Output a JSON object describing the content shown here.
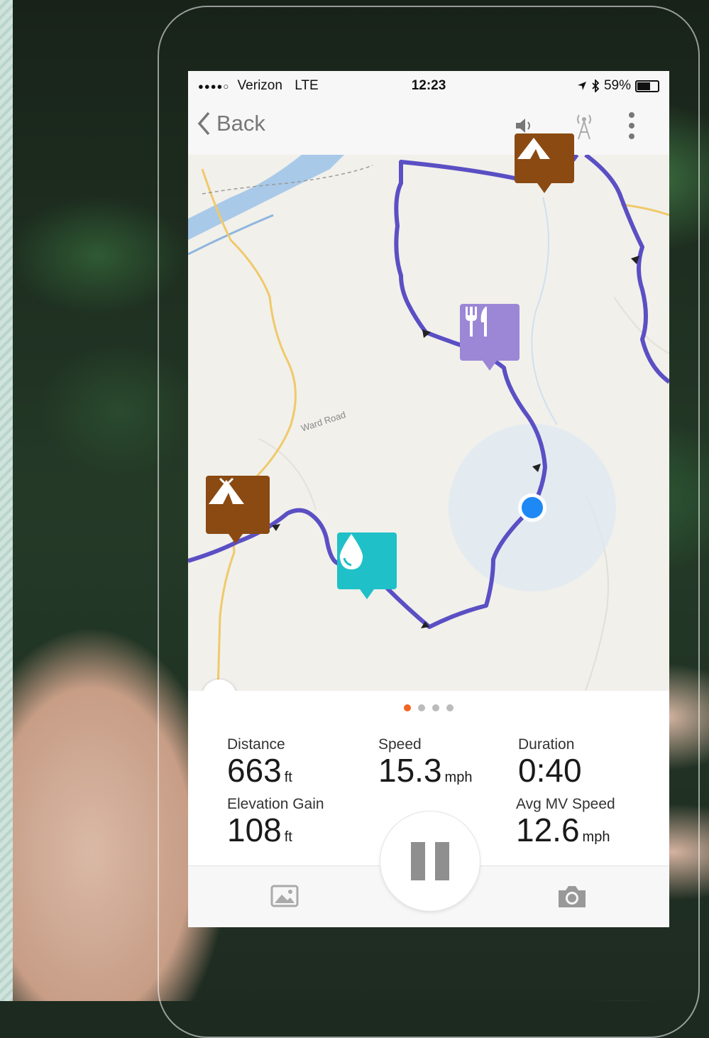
{
  "status_bar": {
    "signal": "●●●●○",
    "carrier": "Verizon",
    "network": "LTE",
    "time": "12:23",
    "battery": "59%"
  },
  "nav": {
    "back_label": "Back"
  },
  "map": {
    "road_label": "Ward Road",
    "route_color": "#5b4fc4"
  },
  "pager": {
    "pages": 4,
    "active": 1
  },
  "stats": {
    "distance": {
      "label": "Distance",
      "value": "663",
      "unit": "ft"
    },
    "speed": {
      "label": "Speed",
      "value": "15.3",
      "unit": "mph"
    },
    "duration": {
      "label": "Duration",
      "value": "0:40"
    },
    "elevation_gain": {
      "label": "Elevation Gain",
      "value": "108",
      "unit": "ft"
    },
    "avg_mv_speed": {
      "label": "Avg MV Speed",
      "value": "12.6",
      "unit": "mph"
    }
  },
  "icons": {
    "campsite_color": "#8a4a12",
    "food_color": "#9b87d6",
    "water_color": "#1fc0c8",
    "location_color": "#1e88f5",
    "pager_active_color": "#f26522"
  }
}
